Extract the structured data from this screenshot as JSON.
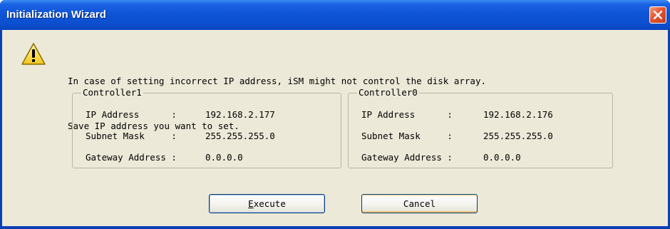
{
  "window": {
    "title": "Initialization Wizard"
  },
  "message": {
    "line1": "In case of setting incorrect IP address, iSM might not control the disk array.",
    "line2": "Save IP address you want to set."
  },
  "controllers": [
    {
      "title": "Controller1",
      "ip_label": "IP Address      : ",
      "ip_value": "192.168.2.177",
      "subnet_label": "Subnet Mask     : ",
      "subnet_value": "255.255.255.0",
      "gateway_label": "Gateway Address : ",
      "gateway_value": "0.0.0.0"
    },
    {
      "title": "Controller0",
      "ip_label": "IP Address      : ",
      "ip_value": "192.168.2.176",
      "subnet_label": "Subnet Mask     : ",
      "subnet_value": "255.255.255.0",
      "gateway_label": "Gateway Address : ",
      "gateway_value": "0.0.0.0"
    }
  ],
  "buttons": {
    "execute_mnemonic": "E",
    "execute_rest": "xecute",
    "cancel": "Cancel"
  },
  "icons": {
    "warning": "warning-icon",
    "close": "close-icon"
  },
  "colors": {
    "titlebar": "#0c50d2",
    "dialog_bg": "#ece9d8",
    "close_button": "#e5542f"
  }
}
